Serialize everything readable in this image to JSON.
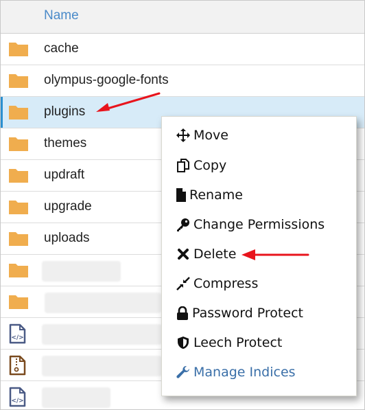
{
  "table": {
    "column_header": "Name",
    "rows": [
      {
        "name": "cache",
        "type": "folder",
        "icon": "folder-icon"
      },
      {
        "name": "olympus-google-fonts",
        "type": "folder",
        "icon": "folder-icon"
      },
      {
        "name": "plugins",
        "type": "folder",
        "icon": "folder-icon",
        "selected": true
      },
      {
        "name": "themes",
        "type": "folder",
        "icon": "folder-icon"
      },
      {
        "name": "updraft",
        "type": "folder",
        "icon": "folder-icon"
      },
      {
        "name": "upgrade",
        "type": "folder",
        "icon": "folder-icon"
      },
      {
        "name": "uploads",
        "type": "folder",
        "icon": "folder-icon"
      },
      {
        "name": "",
        "type": "folder",
        "icon": "folder-icon",
        "redacted": true
      },
      {
        "name": "",
        "type": "folder",
        "icon": "folder-icon",
        "redacted": true
      },
      {
        "name": "",
        "type": "code-file",
        "icon": "code-file-icon",
        "redacted": true
      },
      {
        "name": "",
        "type": "archive-file",
        "icon": "zip-file-icon",
        "redacted": true
      },
      {
        "name": "",
        "type": "code-file",
        "icon": "code-file-icon",
        "redacted": true
      }
    ]
  },
  "context_menu": {
    "items": [
      {
        "label": "Move",
        "icon": "move-icon"
      },
      {
        "label": "Copy",
        "icon": "copy-icon"
      },
      {
        "label": "Rename",
        "icon": "file-icon"
      },
      {
        "label": "Change Permissions",
        "icon": "key-icon"
      },
      {
        "label": "Delete",
        "icon": "delete-x-icon"
      },
      {
        "label": "Compress",
        "icon": "compress-icon"
      },
      {
        "label": "Password Protect",
        "icon": "lock-icon"
      },
      {
        "label": "Leech Protect",
        "icon": "shield-icon"
      },
      {
        "label": "Manage Indices",
        "icon": "wrench-icon"
      }
    ]
  },
  "colors": {
    "header_text": "#4a8ac9",
    "folder": "#f0ad4e",
    "selected_row": "#d7ebf8",
    "annotation_arrow": "#e8141c",
    "link_item": "#3a6fa8"
  }
}
